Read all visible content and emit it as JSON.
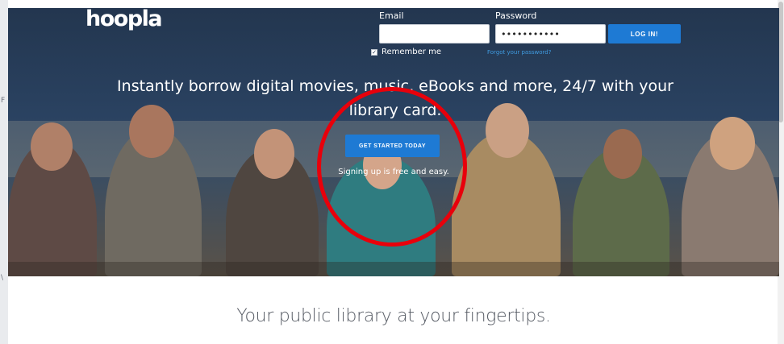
{
  "header": {
    "logo_text": "hoopla"
  },
  "login": {
    "email_label": "Email",
    "email_value": "",
    "password_label": "Password",
    "password_value": "•••••••••••",
    "login_button": "LOG IN!",
    "remember_label": "Remember me",
    "remember_checked": true,
    "forgot_link": "Forgot your password?"
  },
  "hero": {
    "headline_line1": "Instantly borrow digital movies, music, eBooks and more, 24/7 with your",
    "headline_line2": "library card.",
    "cta_button": "GET STARTED TODAY",
    "cta_subtext": "Signing up is free and easy."
  },
  "section": {
    "tagline": "Your public library at your fingertips."
  },
  "annotation": {
    "ring_color": "#e8000b"
  },
  "colors": {
    "accent": "#1e7ad4",
    "hero_background": "#2a4261",
    "link": "#3f9be0"
  },
  "edge_marks": [
    "F",
    "\\"
  ]
}
